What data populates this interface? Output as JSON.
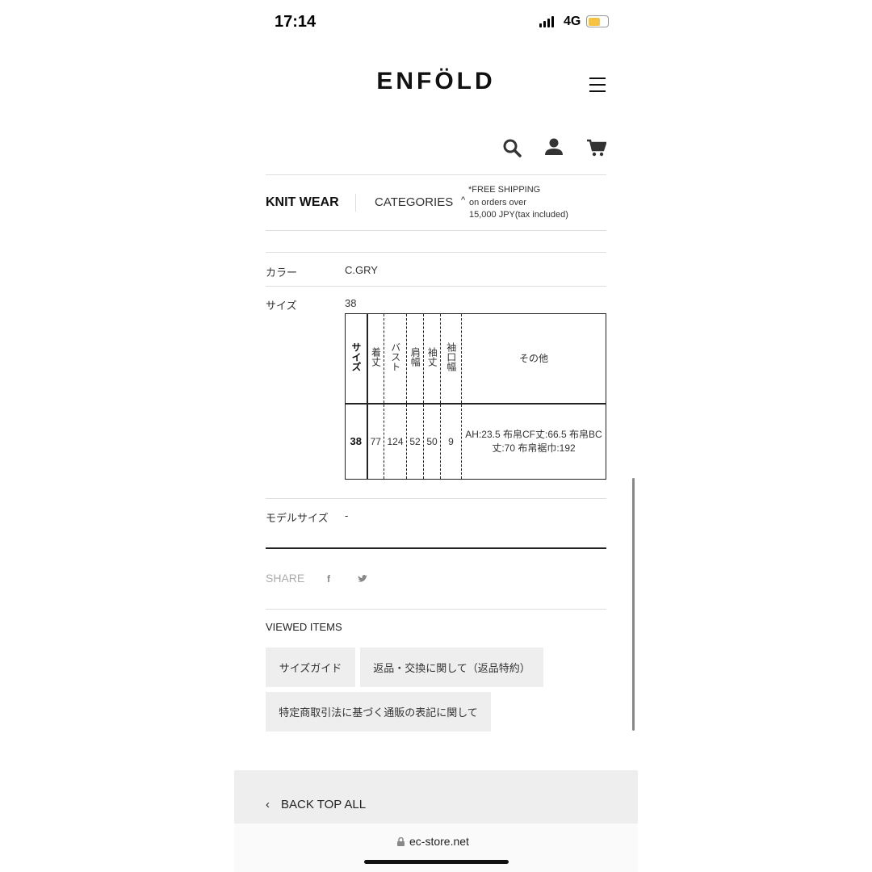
{
  "status": {
    "time": "17:14",
    "network": "4G"
  },
  "header": {
    "logo": "ENFÖLD"
  },
  "nav": {
    "category": "KNIT WEAR",
    "categories_label": "CATEGORIES",
    "shipping": [
      "*FREE SHIPPING",
      "on orders over",
      "15,000 JPY(tax included)"
    ]
  },
  "details": {
    "color_label": "カラー",
    "color_value": "C.GRY",
    "size_label": "サイズ",
    "size_value": "38",
    "model_label": "モデルサイズ",
    "model_value": "-"
  },
  "size_table": {
    "headers": [
      "サイズ",
      "着丈",
      "バスト",
      "肩幅",
      "袖丈",
      "袖口幅",
      "その他"
    ],
    "rows": [
      [
        "38",
        "77",
        "124",
        "52",
        "50",
        "9",
        "AH:23.5 布帛CF丈:66.5 布帛BC丈:70 布帛裾巾:192"
      ]
    ]
  },
  "share": {
    "label": "SHARE"
  },
  "viewed": {
    "label": "VIEWED ITEMS"
  },
  "links": [
    "サイズガイド",
    "返品・交換に関して（返品特約）",
    "特定商取引法に基づく通販の表記に関して"
  ],
  "footer": {
    "back": "BACK TOP ALL"
  },
  "browser": {
    "url": "ec-store.net"
  }
}
